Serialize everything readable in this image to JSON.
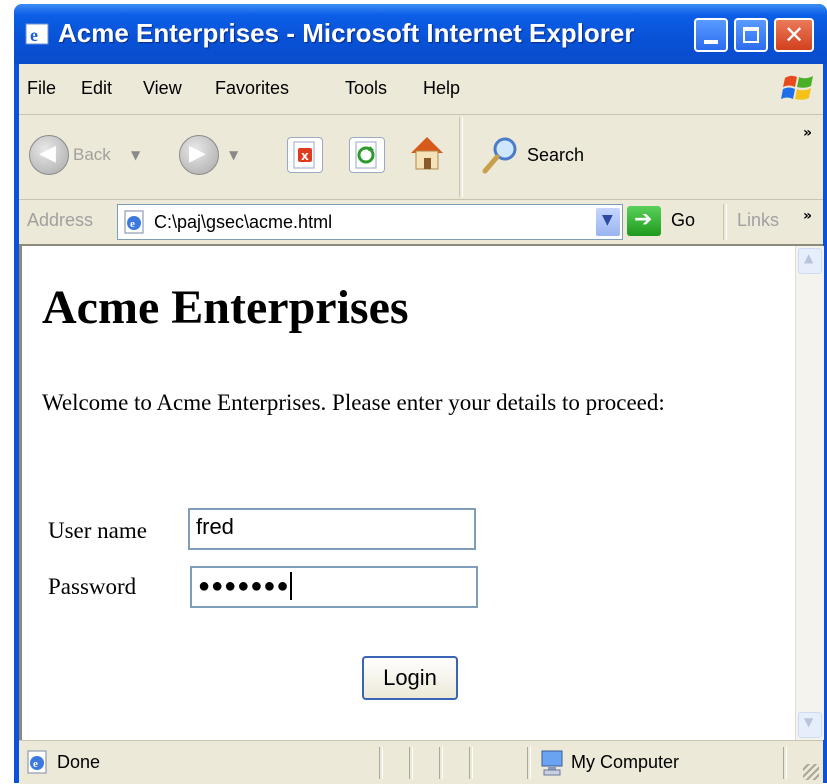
{
  "window": {
    "title": "Acme Enterprises - Microsoft Internet Explorer",
    "close_glyph": "✕"
  },
  "menu": [
    "File",
    "Edit",
    "View",
    "Favorites",
    "Tools",
    "Help"
  ],
  "toolbar": {
    "back_label": "Back",
    "search_label": "Search",
    "overflow": "»"
  },
  "address": {
    "label": "Address",
    "url": "C:\\paj\\gsec\\acme.html",
    "go_label": "Go",
    "links_label": "Links",
    "overflow": "»"
  },
  "page": {
    "heading": "Acme Enterprises",
    "welcome": "Welcome to Acme Enterprises. Please enter your details to proceed:",
    "username_label": "User name",
    "username_value": "fred",
    "password_label": "Password",
    "password_value": "●●●●●●●",
    "login_label": "Login"
  },
  "status": {
    "text": "Done",
    "zone": "My Computer"
  },
  "colors": {
    "titlebar": "#0a52dc",
    "chrome": "#ece9d8",
    "input_border": "#7f9db9"
  }
}
